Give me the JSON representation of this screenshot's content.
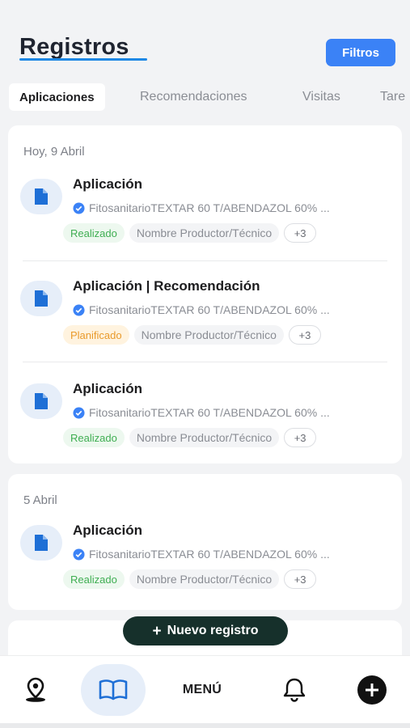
{
  "header": {
    "title": "Registros",
    "filter_label": "Filtros",
    "accent_color": "#3b82f6"
  },
  "tabs": [
    {
      "label": "Aplicaciones",
      "active": true
    },
    {
      "label": "Recomendaciones",
      "active": false
    },
    {
      "label": "Visitas",
      "active": false
    },
    {
      "label": "Tare",
      "active": false
    }
  ],
  "groups": [
    {
      "date": "Hoy, 9 Abril",
      "entries": [
        {
          "title": "Aplicación",
          "detail": "FitosanitarioTEXTAR 60 T/ABENDAZOL 60% ...",
          "status": "Realizado",
          "producer": "Nombre Productor/Técnico",
          "more": "+3"
        },
        {
          "title": "Aplicación | Recomendación",
          "detail": "FitosanitarioTEXTAR 60 T/ABENDAZOL 60% ...",
          "status": "Planificado",
          "producer": "Nombre Productor/Técnico",
          "more": "+3"
        },
        {
          "title": "Aplicación",
          "detail": "FitosanitarioTEXTAR 60 T/ABENDAZOL 60% ...",
          "status": "Realizado",
          "producer": "Nombre Productor/Técnico",
          "more": "+3"
        }
      ]
    },
    {
      "date": "5 Abril",
      "entries": [
        {
          "title": "Aplicación",
          "detail": "FitosanitarioTEXTAR 60 T/ABENDAZOL 60% ...",
          "status": "Realizado",
          "producer": "Nombre Productor/Técnico",
          "more": "+3"
        }
      ]
    }
  ],
  "new_record": {
    "label": "Nuevo registro",
    "icon": "plus-icon"
  },
  "bottom_nav": {
    "items": [
      {
        "icon": "map-pin-icon"
      },
      {
        "icon": "book-icon",
        "active": true
      },
      {
        "label": "MENÚ"
      },
      {
        "icon": "bell-icon"
      },
      {
        "icon": "plus-circle-icon"
      }
    ]
  },
  "colors": {
    "status_done": "#3fae52",
    "status_planned": "#e99a2b",
    "icon_blue": "#1e6fd6",
    "dark_button": "#16302b"
  }
}
